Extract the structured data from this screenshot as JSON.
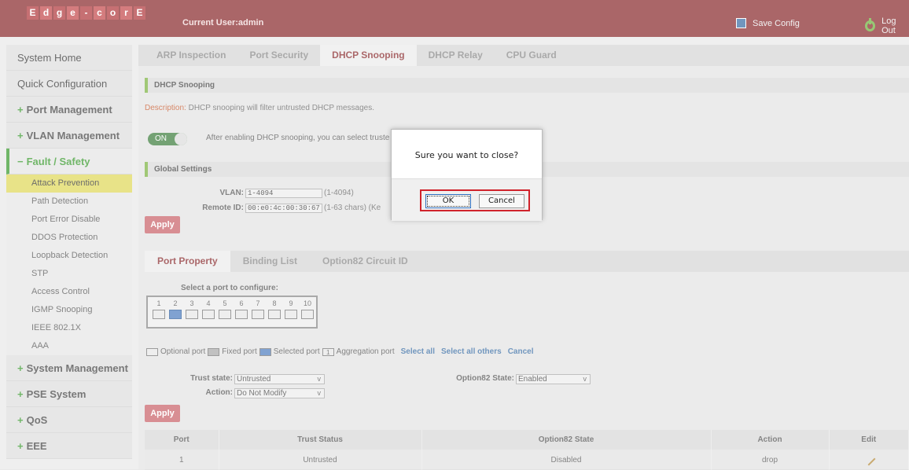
{
  "header": {
    "logo_letters": [
      "E",
      "d",
      "g",
      "e",
      "-",
      "c",
      "o",
      "r",
      "E"
    ],
    "current_user": "Current User:admin",
    "save_config": "Save Config",
    "log_out": "Log Out"
  },
  "sidebar": {
    "items": [
      {
        "label": "System Home"
      },
      {
        "label": "Quick Configuration"
      },
      {
        "label": "Port Management"
      },
      {
        "label": "VLAN Management"
      },
      {
        "label": "Fault / Safety"
      },
      {
        "label": "System Management"
      },
      {
        "label": "PSE System"
      },
      {
        "label": "QoS"
      },
      {
        "label": "EEE"
      }
    ],
    "subitems": [
      "Attack Prevention",
      "Path Detection",
      "Port Error Disable",
      "DDOS Protection",
      "Loopback Detection",
      "STP",
      "Access Control",
      "IGMP Snooping",
      "IEEE 802.1X",
      "AAA"
    ]
  },
  "tabs": [
    "ARP Inspection",
    "Port Security",
    "DHCP Snooping",
    "DHCP Relay",
    "CPU Guard"
  ],
  "section_dhcp": "DHCP Snooping",
  "description_label": "Description:",
  "description_text": "DHCP snooping will filter untrusted DHCP messages.",
  "toggle": {
    "label": "ON",
    "text": "After enabling DHCP snooping, you can select truste"
  },
  "section_global": "Global Settings",
  "global": {
    "vlan_label": "VLAN:",
    "vlan_value": "1-4094",
    "vlan_hint": "(1-4094)",
    "remote_label": "Remote ID:",
    "remote_value": "00:e0:4c:00:30:67",
    "remote_hint": "(1-63 chars) (Ke"
  },
  "apply_label": "Apply",
  "subtabs": [
    "Port Property",
    "Binding List",
    "Option82 Circuit ID"
  ],
  "port_select_title": "Select a port to configure:",
  "ports": [
    "1",
    "2",
    "3",
    "4",
    "5",
    "6",
    "7",
    "8",
    "9",
    "10"
  ],
  "selected_port": "2",
  "legend": {
    "optional": "Optional port",
    "fixed": "Fixed port",
    "selected": "Selected port",
    "aggregation_icon": "1",
    "aggregation": "Aggregation port",
    "select_all": "Select all",
    "select_others": "Select all others",
    "cancel": "Cancel"
  },
  "form": {
    "trust_label": "Trust state:",
    "trust_value": "Untrusted",
    "action_label": "Action:",
    "action_value": "Do Not Modify",
    "opt82_label": "Option82 State:",
    "opt82_value": "Enabled"
  },
  "table": {
    "headers": [
      "Port",
      "Trust Status",
      "Option82 State",
      "Action",
      "Edit"
    ],
    "rows": [
      {
        "port": "1",
        "trust": "Untrusted",
        "opt82": "Disabled",
        "action": "drop"
      }
    ]
  },
  "dialog": {
    "message": "Sure you want to close?",
    "ok": "OK",
    "cancel": "Cancel",
    "highlight_color": "#d0232b"
  },
  "colors": {
    "brand": "#8a2c2f",
    "accent_green": "#3a9a2e",
    "apply": "#c9636a"
  }
}
